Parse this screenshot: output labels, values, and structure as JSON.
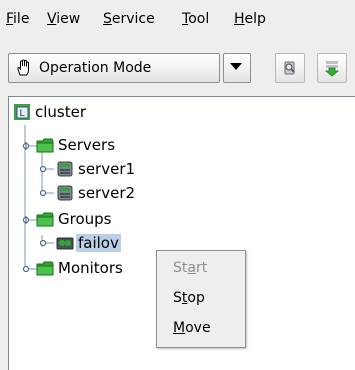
{
  "menu": {
    "file": {
      "mnemonic": "F",
      "rest": "ile"
    },
    "view": {
      "mnemonic": "V",
      "rest": "iew"
    },
    "service": {
      "mnemonic": "S",
      "rest": "ervice"
    },
    "tool": {
      "mnemonic": "T",
      "rest": "ool"
    },
    "help": {
      "mnemonic": "H",
      "rest": "elp"
    }
  },
  "toolbar": {
    "mode_selected": "Operation Mode",
    "mode_icon": "hand-pointer-icon",
    "button1_icon": "search-server-icon",
    "button2_icon": "download-arrow-icon"
  },
  "tree": {
    "root": "cluster",
    "servers": "Servers",
    "server1": "server1",
    "server2": "server2",
    "groups": "Groups",
    "failover_visible": "failov",
    "monitors": "Monitors"
  },
  "context_menu": {
    "start": {
      "pre": "St",
      "mnemonic": "a",
      "post": "rt",
      "enabled": false
    },
    "stop": {
      "pre": "S",
      "mnemonic": "t",
      "post": "op",
      "enabled": true
    },
    "move": {
      "pre": "",
      "mnemonic": "M",
      "post": "ove",
      "enabled": true
    }
  },
  "colors": {
    "selection": "#b8cfe5",
    "folder_green": "#2fa82f",
    "disabled_text": "#8f8f8f"
  }
}
